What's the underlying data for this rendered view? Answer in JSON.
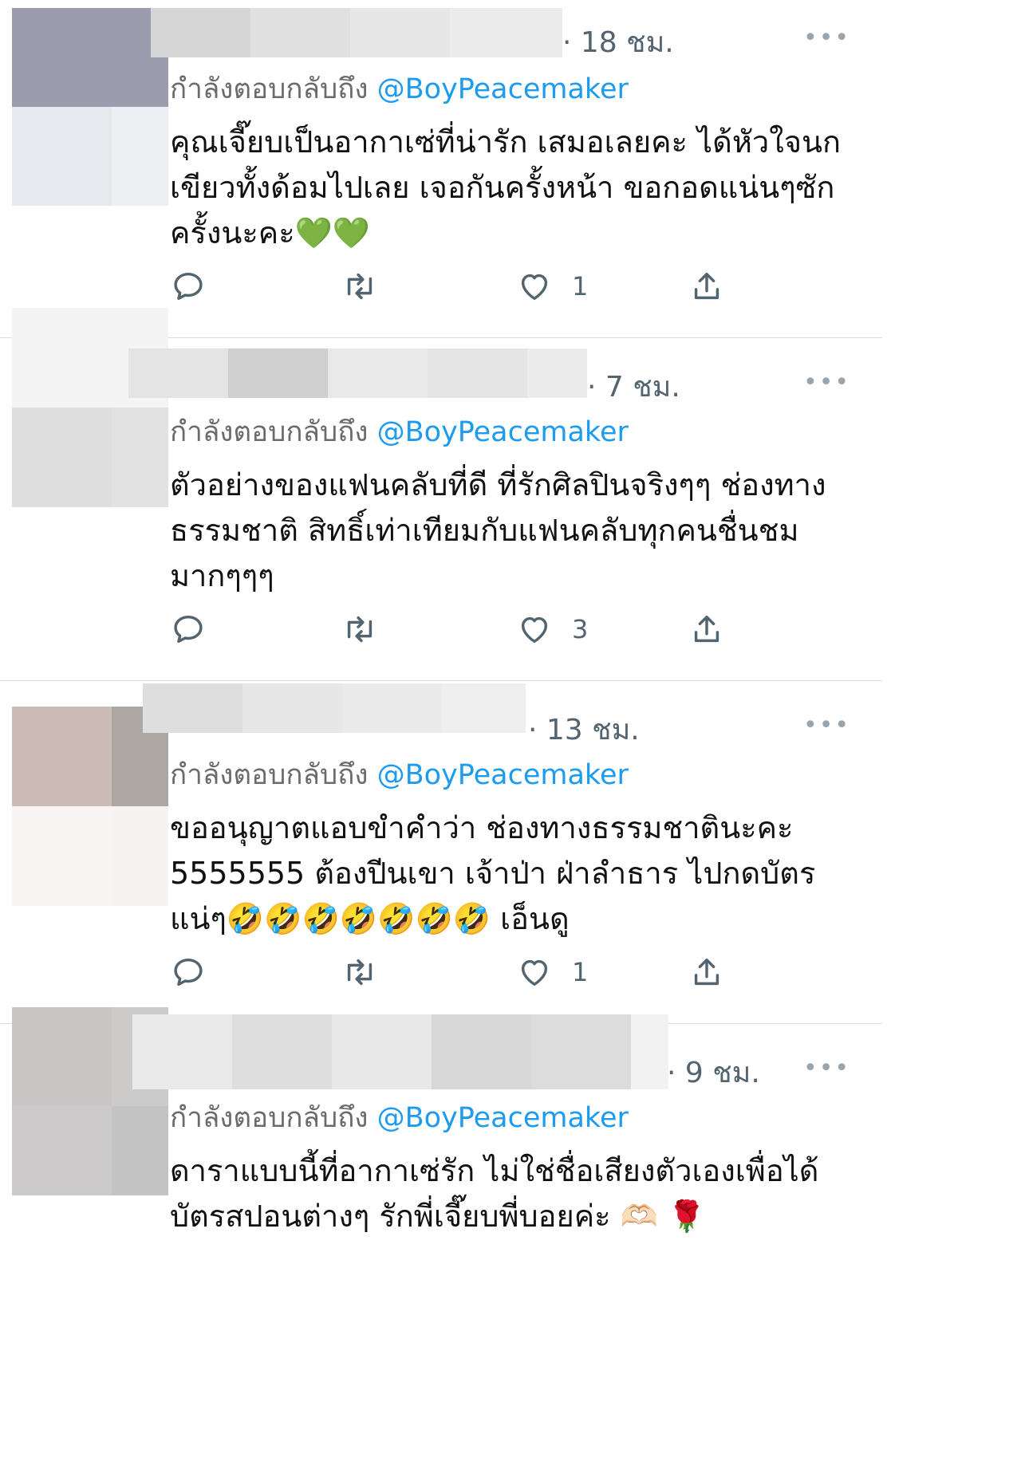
{
  "tweets": [
    {
      "time": "· 18 ชม.",
      "reply_prefix": "กำลังตอบกลับถึง",
      "reply_handle": "@BoyPeacemaker",
      "text": "คุณเจี๊ยบเป็นอากาเซ่ที่น่ารัก เสมอเลยคะ ได้หัวใจนกเขียวทั้งด้อมไปเลย เจอกันครั้งหน้า ขอกอดแน่นๆซักครั้งนะคะ💚💚",
      "like_count": "1",
      "more": "•••"
    },
    {
      "time": "· 7 ชม.",
      "reply_prefix": "กำลังตอบกลับถึง",
      "reply_handle": "@BoyPeacemaker",
      "text": "ตัวอย่างของแฟนคลับที่ดี ที่รักศิลปินจริงๆๆ ช่องทางธรรมชาติ สิทธิ์เท่าเทียมกับแฟนคลับทุกคนชื่นชมมากๆๆๆ",
      "like_count": "3",
      "more": "•••"
    },
    {
      "time": "· 13 ชม.",
      "reply_prefix": "กำลังตอบกลับถึง",
      "reply_handle": "@BoyPeacemaker",
      "text": "ขออนุญาตแอบขำคำว่า ช่องทางธรรมชาตินะคะ 5555555 ต้องปีนเขา เจ้าป่า ฝ่าลำธาร ไปกดบัตรแน่ๆ🤣🤣🤣🤣🤣🤣🤣 เอ็นดู",
      "like_count": "1",
      "more": "•••"
    },
    {
      "time": "· 9 ชม.",
      "reply_prefix": "กำลังตอบกลับถึง",
      "reply_handle": "@BoyPeacemaker",
      "text": "ดาราแบบนี้ที่อากาเซ่รัก ไม่ใช่ชื่อเสียงตัวเองเพื่อได้บัตรสปอนต่างๆ รักพี่เจี๊ยบพี่บอยค่ะ 🫶🏻 🌹",
      "more": "•••"
    }
  ],
  "icons": [
    "reply-icon",
    "retweet-icon",
    "like-icon",
    "share-icon",
    "more-icon"
  ],
  "colors": {
    "mention": "#1d9bf0",
    "meta": "#536471",
    "divider": "#dcdcdc"
  }
}
